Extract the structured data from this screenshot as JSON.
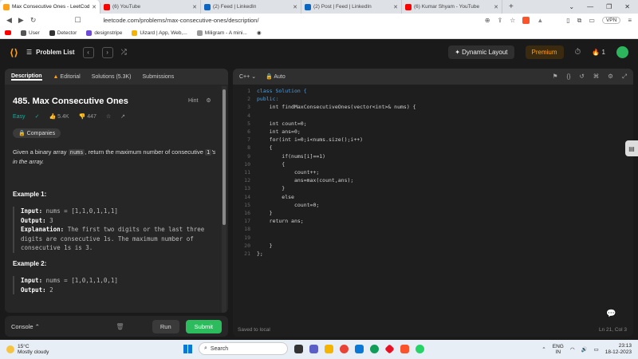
{
  "browser": {
    "tabs": [
      {
        "label": "Max Consecutive Ones - LeetCod",
        "color": "#ffa116",
        "active": true
      },
      {
        "label": "(6) YouTube",
        "color": "#ff0000"
      },
      {
        "label": "(2) Feed | LinkedIn",
        "color": "#0a66c2"
      },
      {
        "label": "(2) Post | Feed | LinkedIn",
        "color": "#0a66c2"
      },
      {
        "label": "(6) Kumar Shyam - YouTube",
        "color": "#ff0000"
      }
    ],
    "url": "leetcode.com/problems/max-consecutive-ones/description/",
    "vpn": "VPN",
    "bookmarks": [
      {
        "label": "User",
        "color": "#555"
      },
      {
        "label": "Detector",
        "color": "#333"
      },
      {
        "label": "designstripe",
        "color": "#6b4bd8"
      },
      {
        "label": "Uizard | App, Web,...",
        "color": "#f5b400"
      },
      {
        "label": "Miligram - A mini...",
        "color": "#999"
      }
    ]
  },
  "lc": {
    "problem_list": "Problem List",
    "dynamic_layout": "Dynamic Layout",
    "premium": "Premium",
    "streak": "1"
  },
  "left": {
    "tabs": [
      "Description",
      "Editorial",
      "Solutions (5.3K)",
      "Submissions"
    ],
    "title": "485. Max Consecutive Ones",
    "hint": "Hint",
    "difficulty": "Easy",
    "likes": "5.4K",
    "dislikes": "447",
    "companies": "Companies",
    "desc_pre": "Given a binary array ",
    "desc_code": "nums",
    "desc_post": ", return the maximum number of consecutive ",
    "desc_code2": "1",
    "desc_end": "'s in the array.",
    "ex1_title": "Example 1:",
    "ex1_input_label": "Input:",
    "ex1_input": "nums = [1,1,0,1,1,1]",
    "ex1_output_label": "Output:",
    "ex1_output": "3",
    "ex1_expl_label": "Explanation:",
    "ex1_expl": "The first two digits or the last three digits are consecutive 1s. The maximum number of consecutive 1s is 3.",
    "ex2_title": "Example 2:",
    "ex2_input_label": "Input:",
    "ex2_input": "nums = [1,0,1,1,0,1]",
    "ex2_output_label": "Output:",
    "ex2_output": "2"
  },
  "console": {
    "label": "Console",
    "run": "Run",
    "submit": "Submit"
  },
  "editor": {
    "language": "C++",
    "mode": "Auto",
    "code": [
      "class Solution {",
      "public:",
      "    int findMaxConsecutiveOnes(vector<int>& nums) {",
      "",
      "    int count=0;",
      "    int ans=0;",
      "    for(int i=0;i<nums.size();i++)",
      "    {",
      "        if(nums[i]==1)",
      "        {",
      "            count++;",
      "            ans=max(count,ans);",
      "        }",
      "        else",
      "            count=0;",
      "    }",
      "    return ans;",
      "",
      "",
      "    }",
      "};"
    ],
    "saved": "Saved to local",
    "cursor": "Ln 21, Col 3"
  },
  "taskbar": {
    "temp": "15°C",
    "weather": "Mostly cloudy",
    "search": "Search",
    "lang1": "ENG",
    "lang2": "IN",
    "time": "23:13",
    "date": "18-12-2023"
  }
}
